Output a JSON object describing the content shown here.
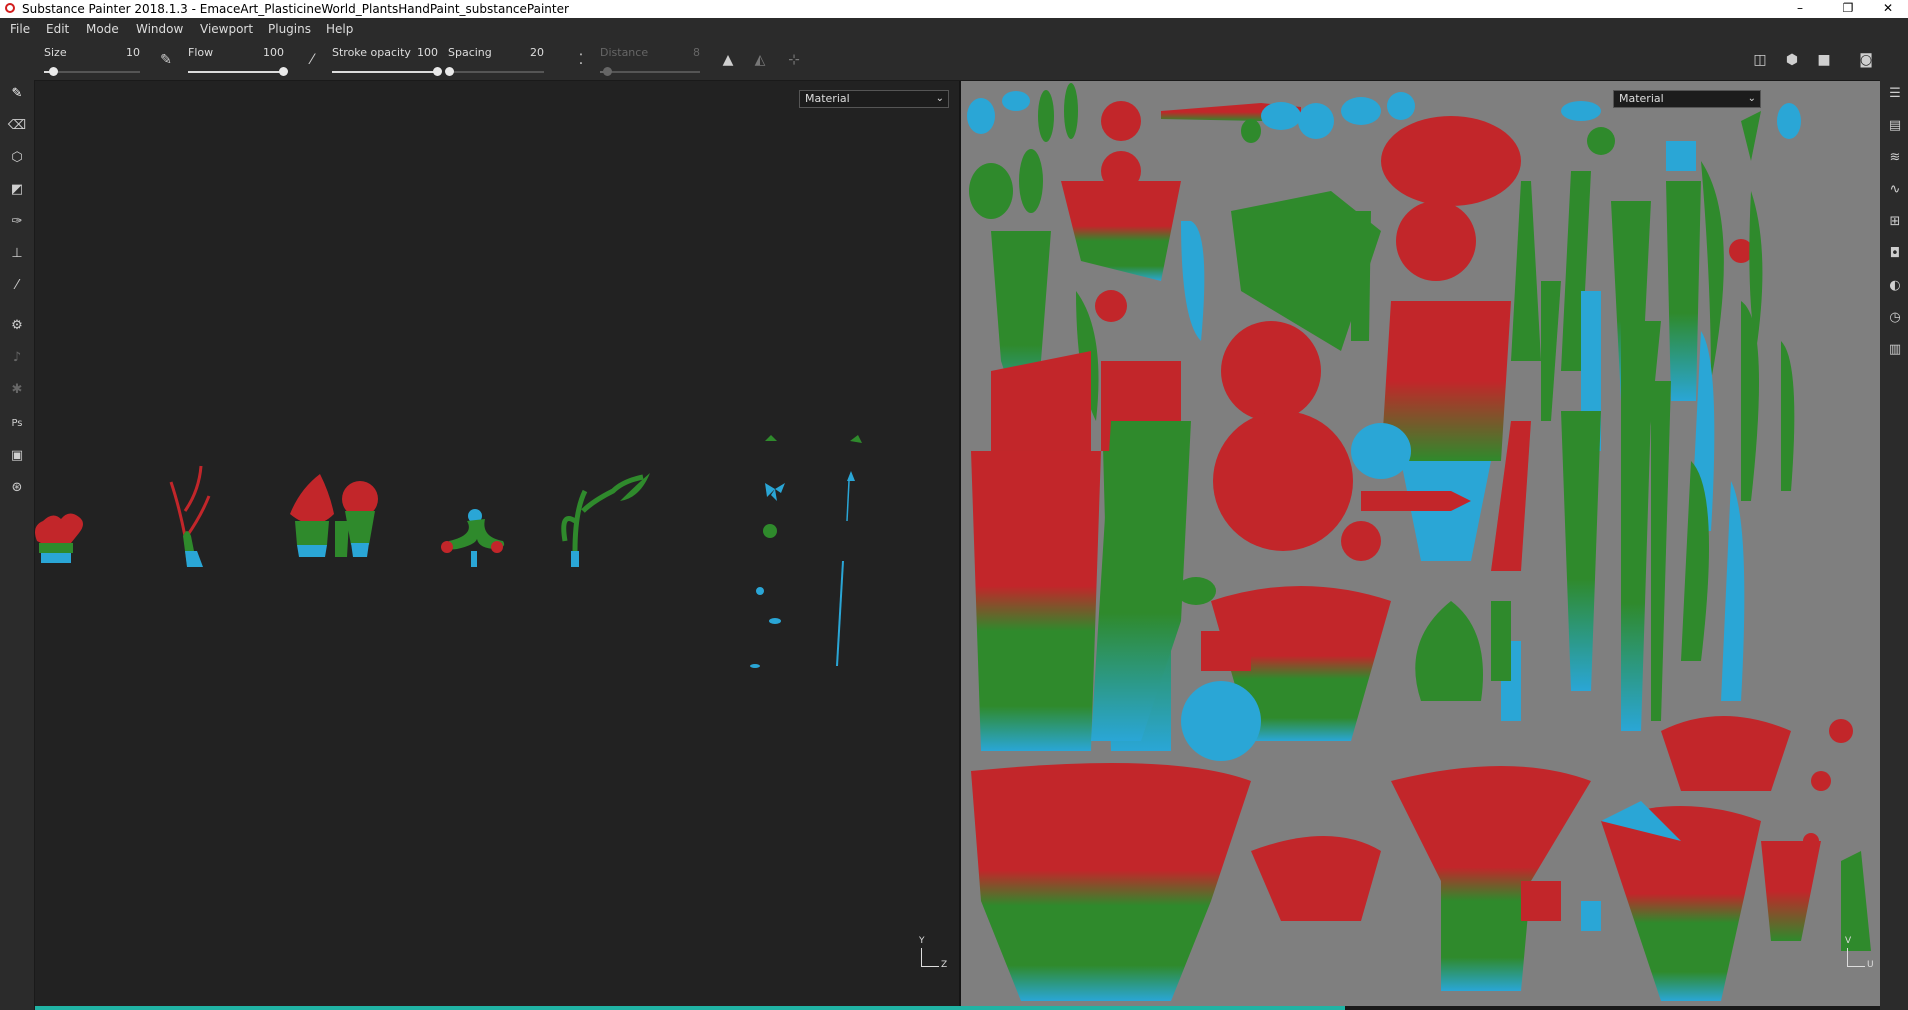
{
  "window": {
    "title": "Substance Painter 2018.1.3 - EmaceArt_PlasticineWorld_PlantsHandPaint_substancePainter",
    "minimize": "–",
    "maximize": "❐",
    "close": "✕"
  },
  "menu": {
    "items": [
      "File",
      "Edit",
      "Mode",
      "Window",
      "Viewport",
      "Plugins",
      "Help"
    ]
  },
  "toolbar": {
    "size": {
      "label": "Size",
      "value": "10",
      "fraction": 0.1
    },
    "flow": {
      "label": "Flow",
      "value": "100",
      "fraction": 1.0
    },
    "stroke_opacity": {
      "label": "Stroke opacity",
      "value": "100",
      "fraction": 1.0
    },
    "spacing": {
      "label": "Spacing",
      "value": "20",
      "fraction": 0.02
    },
    "distance": {
      "label": "Distance",
      "value": "8",
      "fraction": 0.08
    }
  },
  "viewport3d": {
    "channel_select": "Material",
    "axes": {
      "y": "Y",
      "z": "Z"
    }
  },
  "viewport2d": {
    "channel_select": "Material",
    "axes": {
      "v": "V",
      "u": "U"
    }
  },
  "colors": {
    "red": "#c2262a",
    "green": "#2f8a2c",
    "blue": "#2aa6d6",
    "accent": "#20b3a4"
  },
  "status": {
    "progress_fraction": 0.71
  }
}
